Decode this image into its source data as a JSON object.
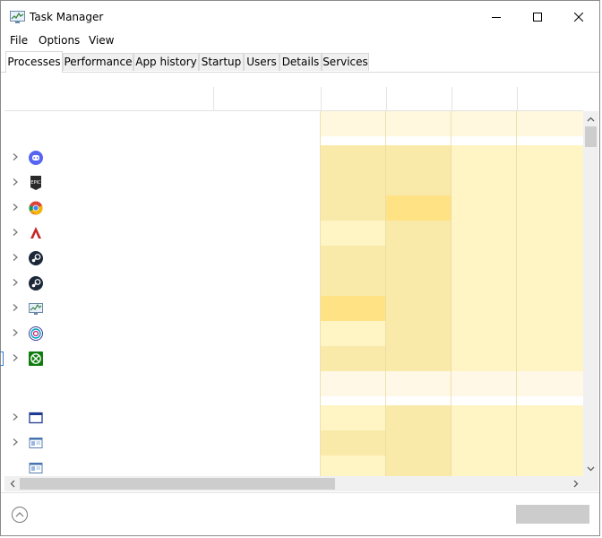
{
  "window": {
    "title": "Task Manager",
    "controls": [
      "minimize",
      "maximize",
      "close"
    ]
  },
  "menu": [
    "File",
    "Options",
    "View"
  ],
  "tabs": [
    {
      "label": "Processes",
      "active": true
    },
    {
      "label": "Performance",
      "active": false
    },
    {
      "label": "App history",
      "active": false
    },
    {
      "label": "Startup",
      "active": false
    },
    {
      "label": "Users",
      "active": false
    },
    {
      "label": "Details",
      "active": false
    },
    {
      "label": "Services",
      "active": false
    }
  ],
  "process_rows": [
    {
      "icon": "discord-icon",
      "expandable": true,
      "heat": [
        "#f9eaa9",
        "#f9eaa9",
        "#fff4c4",
        "#fff4c4"
      ]
    },
    {
      "icon": "epic-games-icon",
      "expandable": true,
      "heat": [
        "#f9eaa9",
        "#f9eaa9",
        "#fff4c4",
        "#fff4c4"
      ]
    },
    {
      "icon": "chrome-icon",
      "expandable": true,
      "heat": [
        "#f9eaa9",
        "#ffe284",
        "#fff4c4",
        "#fff4c4"
      ]
    },
    {
      "icon": "radeon-icon",
      "expandable": true,
      "heat": [
        "#fff4c4",
        "#f9eaa9",
        "#fff4c4",
        "#fff4c4"
      ]
    },
    {
      "icon": "steam-icon",
      "expandable": true,
      "heat": [
        "#f9eaa9",
        "#f9eaa9",
        "#fff4c4",
        "#fff4c4"
      ]
    },
    {
      "icon": "steam-icon",
      "expandable": true,
      "heat": [
        "#f9eaa9",
        "#f9eaa9",
        "#fff4c4",
        "#fff4c4"
      ]
    },
    {
      "icon": "task-manager-icon",
      "expandable": true,
      "heat": [
        "#ffe284",
        "#f9eaa9",
        "#fff4c4",
        "#fff4c4"
      ]
    },
    {
      "icon": "ubisoft-icon",
      "expandable": true,
      "heat": [
        "#fff4c4",
        "#f9eaa9",
        "#fff4c4",
        "#fff4c4"
      ]
    },
    {
      "icon": "xbox-icon",
      "expandable": true,
      "heat": [
        "#f9eaa9",
        "#f9eaa9",
        "#fff4c4",
        "#fff4c4"
      ]
    }
  ],
  "background_rows": [
    {
      "icon": "window-icon",
      "expandable": true,
      "heat": [
        "#fff4c4",
        "#f9eaa9",
        "#fff4c4",
        "#fff4c4"
      ]
    },
    {
      "icon": "app-frame-icon",
      "expandable": true,
      "heat": [
        "#f9eaa9",
        "#f9eaa9",
        "#fff4c4",
        "#fff4c4"
      ]
    },
    {
      "icon": "app-frame-icon",
      "expandable": false,
      "heat": [
        "#fff4c4",
        "#f9eaa9",
        "#fff4c4",
        "#fff4c4"
      ]
    }
  ],
  "colors": {
    "heat_low": "#fff4c4",
    "heat_mid": "#f9eaa9",
    "heat_high": "#ffe284",
    "heat_header": "#fff8df",
    "heat_group": "#fff8e6"
  }
}
